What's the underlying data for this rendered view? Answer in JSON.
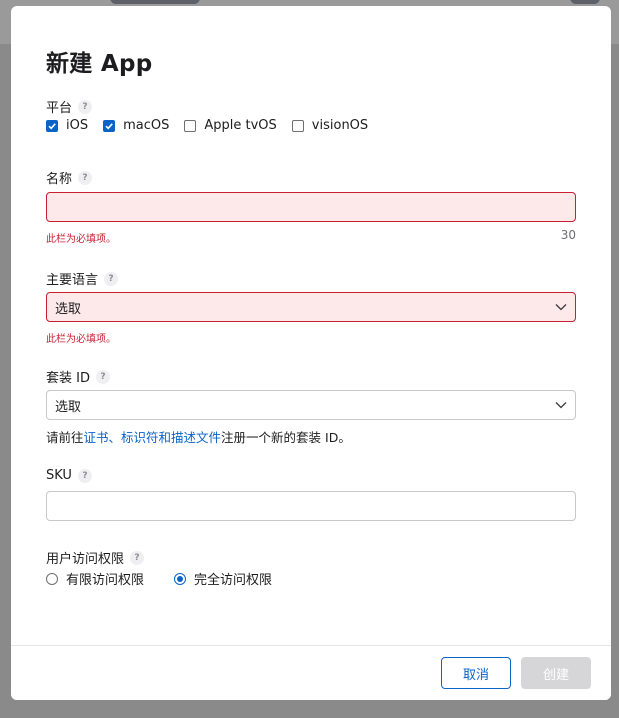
{
  "dialog": {
    "title": "新建 App",
    "help_glyph": "?"
  },
  "platform": {
    "label": "平台",
    "options": [
      {
        "label": "iOS",
        "checked": true
      },
      {
        "label": "macOS",
        "checked": true
      },
      {
        "label": "Apple tvOS",
        "checked": false
      },
      {
        "label": "visionOS",
        "checked": false
      }
    ]
  },
  "name": {
    "label": "名称",
    "value": "",
    "error": "此栏为必填项。",
    "max_length": "30"
  },
  "language": {
    "label": "主要语言",
    "selected": "选取",
    "error": "此栏为必填项。"
  },
  "bundle_id": {
    "label": "套装 ID",
    "selected": "选取",
    "hint_prefix": "请前往",
    "hint_link": "证书、标识符和描述文件",
    "hint_suffix": "注册一个新的套装 ID。"
  },
  "sku": {
    "label": "SKU",
    "value": ""
  },
  "access": {
    "label": "用户访问权限",
    "options": [
      {
        "label": "有限访问权限",
        "selected": false
      },
      {
        "label": "完全访问权限",
        "selected": true
      }
    ]
  },
  "footer": {
    "cancel_label": "取消",
    "create_label": "创建"
  },
  "colors": {
    "accent": "#0a63c7",
    "error": "#c72033",
    "error_bg": "#fde8ea",
    "disabled_button": "#d6d6d9"
  }
}
